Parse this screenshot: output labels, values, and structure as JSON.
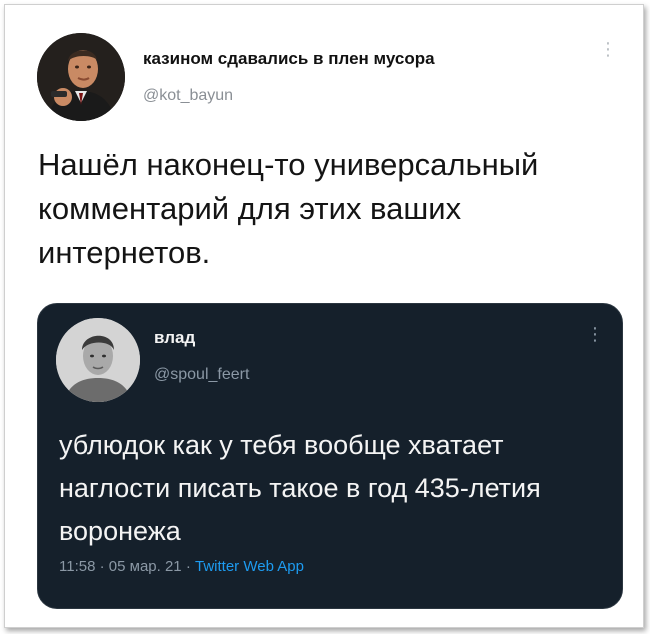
{
  "outer_tweet": {
    "display_name": "казином сдавались в плен мусора",
    "handle": "@kot_bayun",
    "text": "Нашёл наконец-то универсальный комментарий для этих ваших интернетов."
  },
  "quoted_tweet": {
    "display_name": "влад",
    "handle": "@spoul_feert",
    "text": "ублюдок как у тебя вообще хватает наглости писать такое в год 435-летия воронежа",
    "time": "11:58",
    "date": "05 мар. 21",
    "separator": "·",
    "client": "Twitter Web App"
  },
  "icons": {
    "more": "more-vertical-icon"
  },
  "colors": {
    "quote_background": "#15202b",
    "link_blue": "#1d9bf0",
    "muted_gray": "#8b98a5"
  }
}
